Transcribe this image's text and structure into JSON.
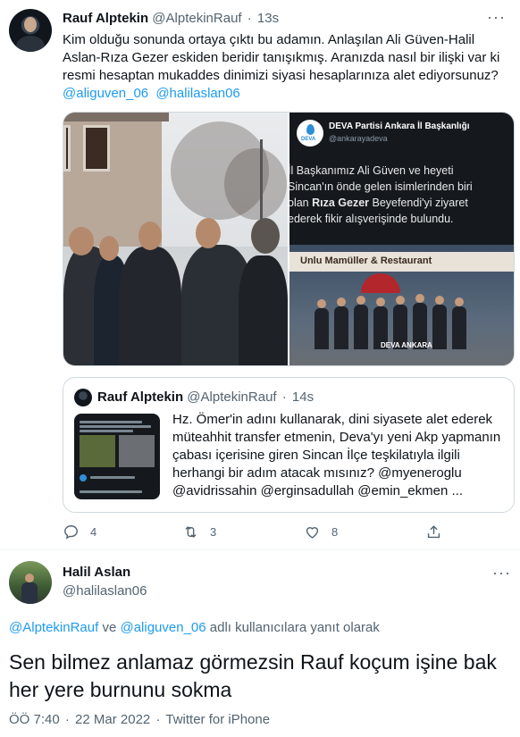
{
  "tweet1": {
    "author_name": "Rauf Alptekin",
    "author_handle": "@AlptekinRauf",
    "time": "13s",
    "text": "Kim olduğu sonunda ortaya çıktı bu adamın. Anlaşılan Ali Güven-Halil Aslan-Rıza Gezer eskiden beridir tanışıkmış. Aranızda nasıl bir ilişki var ki resmi hesaptan mukaddes dinimizi siyasi hesaplarınıza alet ediyorsunuz?",
    "mentions": [
      "@aliguven_06",
      "@halilaslan06"
    ],
    "media_right": {
      "account_name": "DEVA Partisi Ankara İl Başkanlığı",
      "account_handle": "@ankarayadeva",
      "logo_label": "DEVA",
      "line1": "İl Başkanımız Ali Güven ve heyeti",
      "line2": "Sincan'ın önde gelen isimlerinden biri",
      "line3_pre": "olan ",
      "line3_bold": "Rıza Gezer",
      "line3_post": " Beyefendi'yi ziyaret",
      "line4": "ederek fikir alışverişinde bulundu.",
      "shop_sign": "Unlu Mamüller & Restaurant",
      "watermark": "DEVA ANKARA"
    },
    "quote": {
      "author_name": "Rauf Alptekin",
      "author_handle": "@AlptekinRauf",
      "time": "14s",
      "text": "Hz. Ömer'in adını kullanarak, dini siyasete alet ederek müteahhit transfer etmenin, Deva'yı yeni Akp yapmanın çabası içerisine giren Sincan İlçe teşkilatıyla ilgili herhangi bir adım atacak mısınız? @myeneroglu @avidrissahin @erginsadullah @emin_ekmen ..."
    },
    "actions": {
      "replies": "4",
      "retweets": "3",
      "likes": "8"
    },
    "icons": [
      "reply-icon",
      "retweet-icon",
      "like-icon",
      "share-icon",
      "more-icon"
    ]
  },
  "tweet2": {
    "author_name": "Halil Aslan",
    "author_handle": "@halilaslan06",
    "reply_to_user1": "@AlptekinRauf",
    "reply_to_connector": " ve ",
    "reply_to_user2": "@aliguven_06",
    "reply_to_suffix": " adlı kullanıcılara yanıt olarak",
    "text": "Sen bilmez anlamaz görmezsin Rauf koçum işine bak her yere burnunu sokma",
    "time": "ÖÖ 7:40",
    "date": "22 Mar 2022",
    "source": "Twitter for iPhone"
  },
  "colors": {
    "accent": "#1d9bf0",
    "secondary_text": "#536471",
    "primary_text": "#0f1419",
    "border": "#cfd9de"
  }
}
